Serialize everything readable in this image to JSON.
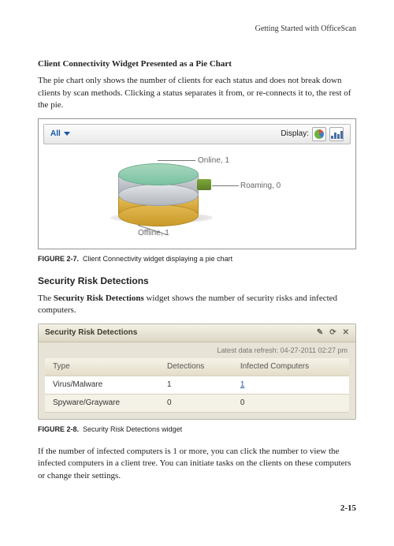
{
  "runhead": "Getting Started with OfficeScan",
  "section1": {
    "title": "Client Connectivity Widget Presented as a Pie Chart",
    "para": "The pie chart only shows the number of clients for each status and does not break down clients by scan methods. Clicking a status separates it from, or re-connects it to, the rest of the pie."
  },
  "fig1": {
    "filter": "All",
    "display_label": "Display:",
    "labels": {
      "online": "Online, 1",
      "roaming": "Roaming, 0",
      "offline": "Offline, 1"
    },
    "caption_no": "FIGURE 2-7.",
    "caption_text": "Client Connectivity widget displaying a pie chart"
  },
  "section2": {
    "heading": "Security Risk Detections",
    "para_lead": "The ",
    "para_bold": "Security Risk Detections",
    "para_tail": " widget shows the number of security risks and infected computers."
  },
  "widget": {
    "title": "Security Risk Detections",
    "refresh": "Latest data refresh: 04-27-2011 02:27 pm",
    "cols": [
      "Type",
      "Detections",
      "Infected Computers"
    ],
    "rows": [
      {
        "type": "Virus/Malware",
        "detections": "1",
        "infected": "1",
        "infected_link": true
      },
      {
        "type": "Spyware/Grayware",
        "detections": "0",
        "infected": "0",
        "infected_link": false
      }
    ]
  },
  "fig2": {
    "caption_no": "FIGURE 2-8.",
    "caption_text": "Security Risk Detections widget"
  },
  "para_after": "If the number of infected computers is 1 or more, you can click the number to view the infected computers in a client tree. You can initiate tasks on the clients on these computers or change their settings.",
  "pagenum": "2-15",
  "chart_data": {
    "type": "pie",
    "title": "Client Connectivity",
    "categories": [
      "Online",
      "Offline",
      "Roaming"
    ],
    "values": [
      1,
      1,
      0
    ],
    "colors": [
      "#7ac2a2",
      "#c99a2a",
      "#6f9a33"
    ]
  }
}
